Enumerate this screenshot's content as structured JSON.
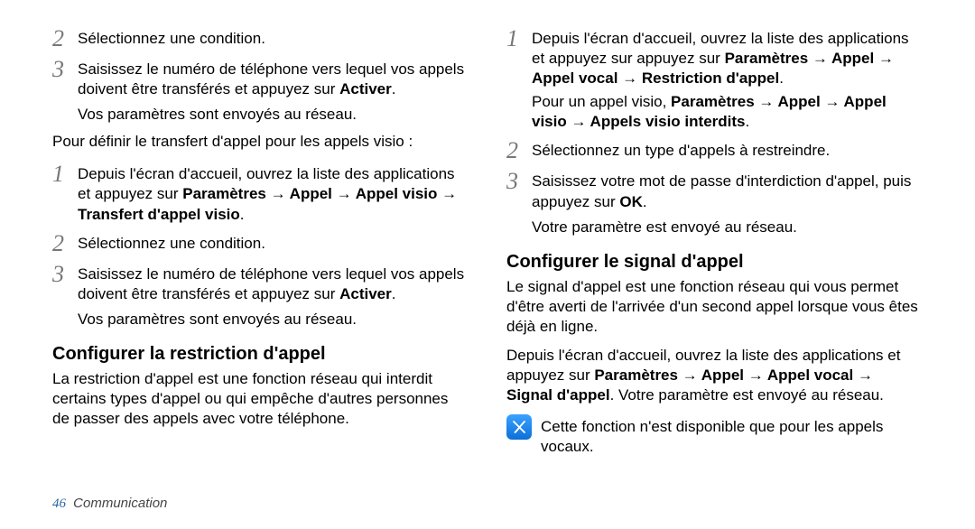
{
  "left": {
    "step2a": "Sélectionnez une condition.",
    "step3a_pre": "Saisissez le numéro de téléphone vers lequel vos appels doivent être transférés et appuyez sur ",
    "step3a_bold": "Activer",
    "sent_note_a": "Vos paramètres sont envoyés au réseau.",
    "visio_intro": "Pour définir le transfert d'appel pour les appels visio :",
    "step1b_pre": "Depuis l'écran d'accueil, ouvrez la liste des applications et  appuyez sur ",
    "step1b_bold": "Paramètres → Appel → Appel visio → Transfert d'appel visio",
    "step2b": "Sélectionnez une condition.",
    "step3b_pre": "Saisissez le numéro de téléphone vers lequel vos appels doivent être transférés et appuyez sur ",
    "step3b_bold": "Activer",
    "sent_note_b": "Vos paramètres sont envoyés au réseau.",
    "h_restriction": "Configurer la restriction d'appel",
    "restriction_desc": "La restriction d'appel est une fonction réseau qui interdit certains types d'appel ou qui empêche d'autres personnes de passer des appels avec votre téléphone."
  },
  "right": {
    "step1_pre": "Depuis l'écran d'accueil, ouvrez la liste des applications et appuyez sur  appuyez sur ",
    "step1_bold": "Paramètres → Appel → Appel vocal → Restriction d'appel",
    "step1_visio_pre": "Pour un appel visio,  ",
    "step1_visio_bold": "Paramètres → Appel → Appel visio → Appels visio interdits",
    "step2": "Sélectionnez un type d'appels à restreindre.",
    "step3_pre": "Saisissez votre mot de passe d'interdiction d'appel, puis appuyez sur ",
    "step3_bold": "OK",
    "sent_note": "Votre paramètre est envoyé au réseau.",
    "h_signal": "Configurer le signal d'appel",
    "signal_desc": "Le signal d'appel est une fonction réseau qui vous permet d'être averti de l'arrivée d'un second appel lorsque vous êtes déjà en ligne.",
    "signal_steps_pre": "Depuis l'écran d'accueil, ouvrez la liste des applications et appuyez sur ",
    "signal_steps_bold": "Paramètres → Appel → Appel vocal → Signal d'appel",
    "signal_steps_post": ". Votre paramètre est envoyé au réseau.",
    "note": "Cette fonction n'est disponible que pour les appels vocaux."
  },
  "footer": {
    "page": "46",
    "section": "Communication"
  },
  "nums": {
    "n1": "1",
    "n2": "2",
    "n3": "3"
  }
}
